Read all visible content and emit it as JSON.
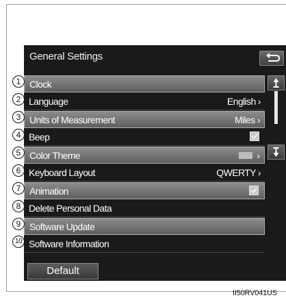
{
  "header": {
    "title": "General Settings"
  },
  "icons": {
    "back": "back-arrow-icon",
    "up": "scroll-up-icon",
    "down": "scroll-down-icon"
  },
  "rows": [
    {
      "num": "1",
      "label": "Clock"
    },
    {
      "num": "2",
      "label": "Language",
      "value": "English"
    },
    {
      "num": "3",
      "label": "Units of Measurement",
      "value": "Miles"
    },
    {
      "num": "4",
      "label": "Beep"
    },
    {
      "num": "5",
      "label": "Color Theme"
    },
    {
      "num": "6",
      "label": "Keyboard Layout",
      "value": "QWERTY"
    },
    {
      "num": "7",
      "label": "Animation"
    },
    {
      "num": "8",
      "label": "Delete Personal Data"
    },
    {
      "num": "9",
      "label": "Software Update"
    },
    {
      "num": "10",
      "label": "Software Information"
    }
  ],
  "footer": {
    "default_label": "Default"
  },
  "image_code": "II50RV041US"
}
